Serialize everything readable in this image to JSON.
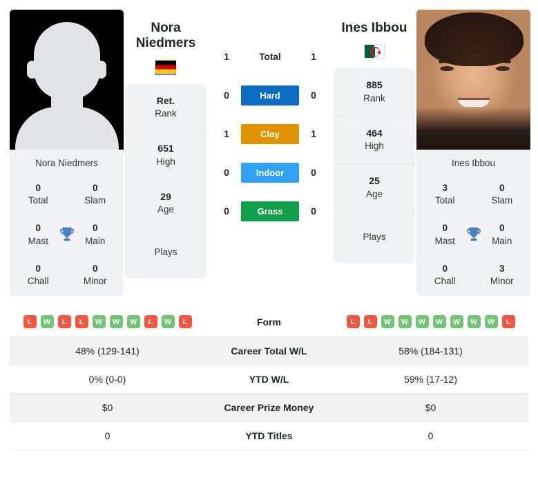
{
  "players": {
    "left": {
      "name_line1": "Nora",
      "name_line2": "Niedmers",
      "full_name": "Nora Niedmers",
      "caption": "Nora Niedmers",
      "flag": "de",
      "flag_name": "germany-flag",
      "photo_type": "placeholder-silhouette",
      "rank": "Ret.",
      "rank_label": "Rank",
      "high": "651",
      "high_label": "High",
      "age": "29",
      "age_label": "Age",
      "plays_label": "Plays",
      "plays_value": "",
      "titles": {
        "total": "0",
        "total_label": "Total",
        "slam": "0",
        "slam_label": "Slam",
        "mast": "0",
        "mast_label": "Mast",
        "main": "0",
        "main_label": "Main",
        "chall": "0",
        "chall_label": "Chall",
        "minor": "0",
        "minor_label": "Minor"
      },
      "form": [
        "L",
        "W",
        "L",
        "L",
        "W",
        "W",
        "W",
        "L",
        "W",
        "L"
      ],
      "surface_scores": {
        "total": "1",
        "hard": "0",
        "clay": "1",
        "indoor": "0",
        "grass": "0"
      },
      "career_total_wl": "48% (129-141)",
      "ytd_wl": "0% (0-0)",
      "career_prize_money": "$0",
      "ytd_titles": "0"
    },
    "right": {
      "name_line1": "Ines Ibbou",
      "name_line2": "",
      "full_name": "Ines Ibbou",
      "caption": "Ines Ibbou",
      "flag": "dz",
      "flag_name": "algeria-flag",
      "photo_type": "portrait-photo",
      "rank": "885",
      "rank_label": "Rank",
      "high": "464",
      "high_label": "High",
      "age": "25",
      "age_label": "Age",
      "plays_label": "Plays",
      "plays_value": "",
      "titles": {
        "total": "3",
        "total_label": "Total",
        "slam": "0",
        "slam_label": "Slam",
        "mast": "0",
        "mast_label": "Mast",
        "main": "0",
        "main_label": "Main",
        "chall": "0",
        "chall_label": "Chall",
        "minor": "3",
        "minor_label": "Minor"
      },
      "form": [
        "L",
        "L",
        "W",
        "W",
        "W",
        "W",
        "W",
        "W",
        "W",
        "L"
      ],
      "surface_scores": {
        "total": "1",
        "hard": "0",
        "clay": "1",
        "indoor": "0",
        "grass": "0"
      },
      "career_total_wl": "58% (184-131)",
      "ytd_wl": "59% (17-12)",
      "career_prize_money": "$0",
      "ytd_titles": "0"
    }
  },
  "surfaces": [
    {
      "key": "total",
      "label": "Total",
      "color": "transparent",
      "plain": true
    },
    {
      "key": "hard",
      "label": "Hard",
      "color": "#0b6bc2",
      "plain": false
    },
    {
      "key": "clay",
      "label": "Clay",
      "color": "#e29400",
      "plain": false
    },
    {
      "key": "indoor",
      "label": "Indoor",
      "color": "#32a2f5",
      "plain": false
    },
    {
      "key": "grass",
      "label": "Grass",
      "color": "#13a04a",
      "plain": false
    }
  ],
  "table": {
    "rows": [
      {
        "label": "Form",
        "type": "form"
      },
      {
        "label": "Career Total W/L",
        "type": "text",
        "key": "career_total_wl"
      },
      {
        "label": "YTD W/L",
        "type": "text",
        "key": "ytd_wl"
      },
      {
        "label": "Career Prize Money",
        "type": "text",
        "key": "career_prize_money"
      },
      {
        "label": "YTD Titles",
        "type": "text",
        "key": "ytd_titles"
      }
    ]
  },
  "icons": {
    "trophy": "trophy-icon",
    "trophy_color": "#4a7fc1"
  },
  "colors": {
    "card_bg": "#f1f2f3",
    "row_odd": "#f2f2f3",
    "row_even": "#ffffff",
    "win": "#74c476",
    "loss": "#f4573f"
  }
}
